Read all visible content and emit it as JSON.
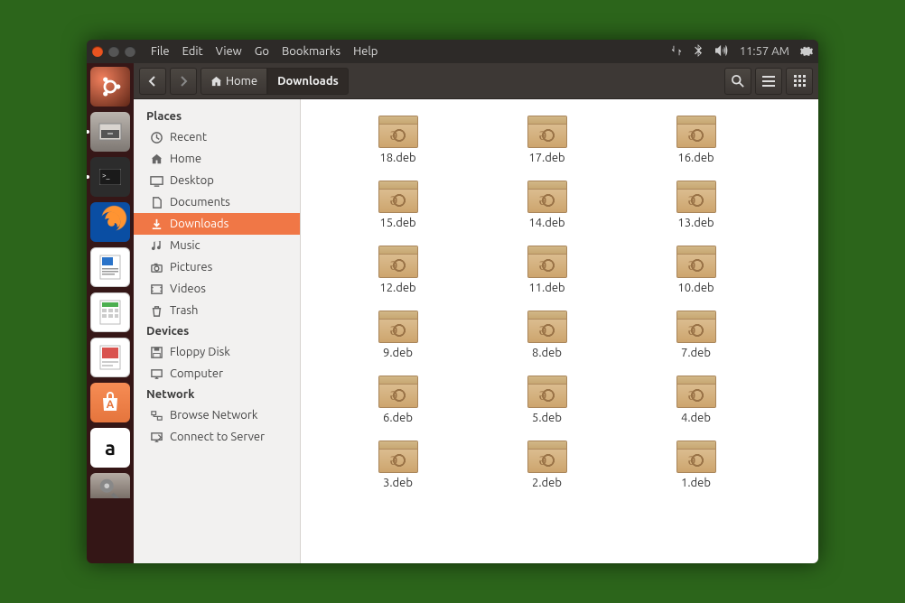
{
  "panel": {
    "menus": [
      "File",
      "Edit",
      "View",
      "Go",
      "Bookmarks",
      "Help"
    ],
    "clock": "11:57 AM"
  },
  "launcher": [
    {
      "name": "ubuntu-dash"
    },
    {
      "name": "files",
      "running": true
    },
    {
      "name": "terminal",
      "running": true
    },
    {
      "name": "firefox"
    },
    {
      "name": "libreoffice-writer"
    },
    {
      "name": "libreoffice-calc"
    },
    {
      "name": "libreoffice-impress"
    },
    {
      "name": "ubuntu-software"
    },
    {
      "name": "amazon"
    },
    {
      "name": "system-settings"
    }
  ],
  "toolbar": {
    "path": [
      {
        "label": "Home",
        "icon": "home",
        "current": false
      },
      {
        "label": "Downloads",
        "current": true
      }
    ]
  },
  "sidebar": {
    "sections": [
      {
        "title": "Places",
        "items": [
          {
            "label": "Recent",
            "icon": "clock"
          },
          {
            "label": "Home",
            "icon": "home"
          },
          {
            "label": "Desktop",
            "icon": "desktop"
          },
          {
            "label": "Documents",
            "icon": "doc"
          },
          {
            "label": "Downloads",
            "icon": "download",
            "selected": true
          },
          {
            "label": "Music",
            "icon": "music"
          },
          {
            "label": "Pictures",
            "icon": "camera"
          },
          {
            "label": "Videos",
            "icon": "video"
          },
          {
            "label": "Trash",
            "icon": "trash"
          }
        ]
      },
      {
        "title": "Devices",
        "items": [
          {
            "label": "Floppy Disk",
            "icon": "floppy"
          },
          {
            "label": "Computer",
            "icon": "computer"
          }
        ]
      },
      {
        "title": "Network",
        "items": [
          {
            "label": "Browse Network",
            "icon": "network"
          },
          {
            "label": "Connect to Server",
            "icon": "server"
          }
        ]
      }
    ]
  },
  "files": [
    {
      "name": "18.deb"
    },
    {
      "name": "17.deb"
    },
    {
      "name": "16.deb"
    },
    {
      "name": "15.deb"
    },
    {
      "name": "14.deb"
    },
    {
      "name": "13.deb"
    },
    {
      "name": "12.deb"
    },
    {
      "name": "11.deb"
    },
    {
      "name": "10.deb"
    },
    {
      "name": "9.deb"
    },
    {
      "name": "8.deb"
    },
    {
      "name": "7.deb"
    },
    {
      "name": "6.deb"
    },
    {
      "name": "5.deb"
    },
    {
      "name": "4.deb"
    },
    {
      "name": "3.deb"
    },
    {
      "name": "2.deb"
    },
    {
      "name": "1.deb"
    }
  ]
}
